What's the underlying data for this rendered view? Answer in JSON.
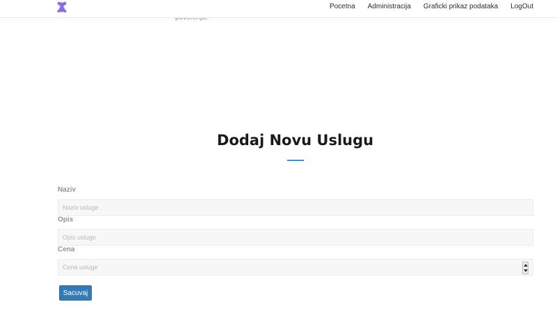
{
  "navbar": {
    "logo_icon": "teddy-bear-icon",
    "logo_color": "#8a6ee0",
    "links": [
      {
        "label": "Pocetna"
      },
      {
        "label": "Administracija"
      },
      {
        "label": "Graficki prikaz podataka"
      },
      {
        "label": "LogOut"
      }
    ]
  },
  "peek_text": "poverenju.",
  "section": {
    "title": "Dodaj Novu Uslugu",
    "accent_color": "#3b8ed8"
  },
  "form": {
    "naziv": {
      "label": "Naziv",
      "placeholder": "Naziv usluge",
      "value": ""
    },
    "opis": {
      "label": "Opis",
      "placeholder": "Opis usluge",
      "value": ""
    },
    "cena": {
      "label": "Cena",
      "placeholder": "Cena usluge",
      "value": ""
    },
    "submit_label": "Sacuvaj",
    "submit_color": "#337ab7"
  }
}
